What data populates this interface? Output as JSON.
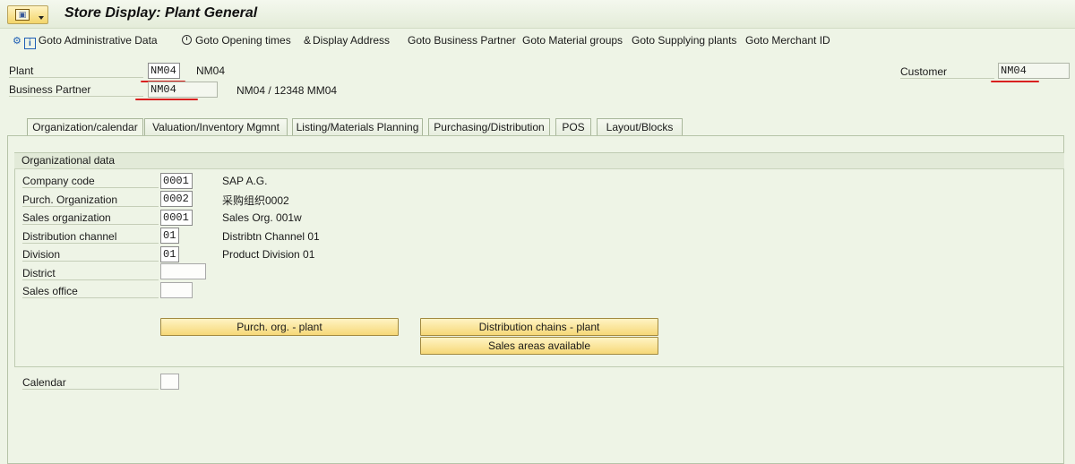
{
  "window": {
    "title": "Store Display: Plant General"
  },
  "toolbar": {
    "items": [
      {
        "label": "Goto Administrative Data",
        "icon": "info-icon"
      },
      {
        "label": "Goto Opening times",
        "icon": "clock-icon"
      },
      {
        "label": "Display Address",
        "icon": "glasses-icon"
      },
      {
        "label": "Goto Business Partner"
      },
      {
        "label": "Goto Material groups"
      },
      {
        "label": "Goto Supplying plants"
      },
      {
        "label": "Goto Merchant ID"
      }
    ]
  },
  "header": {
    "plant_label": "Plant",
    "plant_value": "NM04",
    "plant_desc": "NM04",
    "bp_label": "Business Partner",
    "bp_value": "NM04",
    "bp_desc": "NM04 / 12348 MM04",
    "customer_label": "Customer",
    "customer_value": "NM04"
  },
  "tabs": [
    {
      "label": "Organization/calendar",
      "active": true
    },
    {
      "label": "Valuation/Inventory Mgmnt"
    },
    {
      "label": "Listing/Materials Planning"
    },
    {
      "label": "Purchasing/Distribution"
    },
    {
      "label": "POS"
    },
    {
      "label": "Layout/Blocks"
    }
  ],
  "org_data": {
    "title": "Organizational data",
    "rows": [
      {
        "label": "Company code",
        "value": "0001",
        "desc": "SAP A.G."
      },
      {
        "label": "Purch. Organization",
        "value": "0002",
        "desc": "采购组织0002"
      },
      {
        "label": "Sales organization",
        "value": "0001",
        "desc": "Sales Org. 001w"
      },
      {
        "label": "Distribution channel",
        "value": "01",
        "desc": "Distribtn Channel 01"
      },
      {
        "label": "Division",
        "value": "01",
        "desc": "Product Division 01"
      },
      {
        "label": "District",
        "value": "",
        "desc": ""
      },
      {
        "label": "Sales office",
        "value": "",
        "desc": ""
      }
    ],
    "btn_purch_org": "Purch. org. - plant",
    "btn_dist_chains": "Distribution chains - plant",
    "btn_sales_areas": "Sales areas available"
  },
  "calendar": {
    "label": "Calendar",
    "value": ""
  },
  "colors": {
    "background": "#eef4e6",
    "button": "#f6d878",
    "annotation": "#d92020"
  }
}
